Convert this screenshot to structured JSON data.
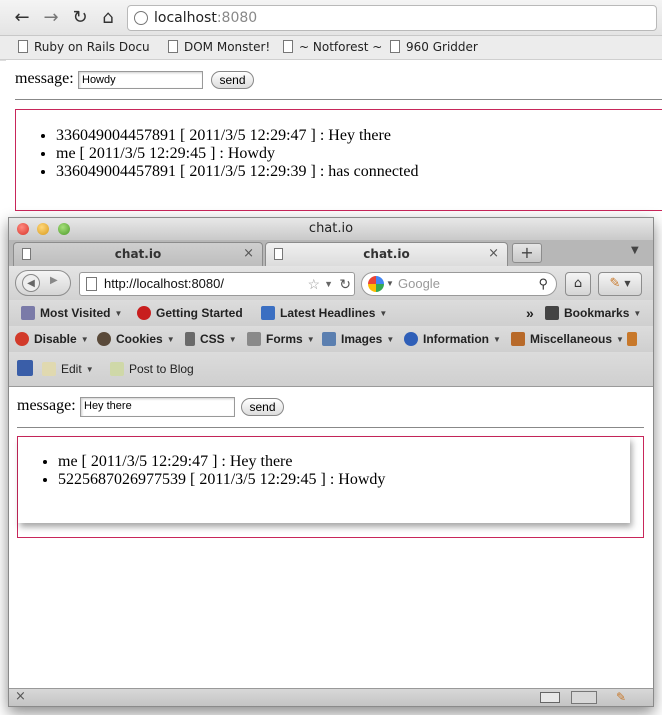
{
  "back_browser": {
    "url_host": "localhost",
    "url_port": ":8080",
    "bookmarks": [
      "Ruby on Rails Docum",
      "DOM Monster!",
      "~ Notforest ~",
      "960 Gridder"
    ],
    "page": {
      "message_label": "message:",
      "input_value": "Howdy",
      "send_label": "send",
      "messages": [
        "336049004457891 [ 2011/3/5 12:29:47 ] : Hey there",
        "me [ 2011/3/5 12:29:45 ] : Howdy",
        "336049004457891 [ 2011/3/5 12:29:39 ] : has connected"
      ]
    }
  },
  "front_window": {
    "title": "chat.io",
    "tabs": [
      {
        "label": "chat.io",
        "active": false
      },
      {
        "label": "chat.io",
        "active": true
      }
    ],
    "new_tab": "+",
    "url": "http://localhost:8080/",
    "search_placeholder": "Google",
    "bookmarks_bar": {
      "most_visited": "Most Visited",
      "getting_started": "Getting Started",
      "latest_headlines": "Latest Headlines",
      "bookmarks": "Bookmarks",
      "overflow": "»"
    },
    "webdev_bar": {
      "disable": "Disable",
      "cookies": "Cookies",
      "css": "CSS",
      "forms": "Forms",
      "images": "Images",
      "information": "Information",
      "miscellaneous": "Miscellaneous"
    },
    "blog_bar": {
      "edit": "Edit",
      "post_to_blog": "Post to Blog"
    },
    "page": {
      "message_label": "message:",
      "input_value": "Hey there",
      "send_label": "send",
      "messages": [
        "me [ 2011/3/5 12:29:47 ] : Hey there",
        "5225687026977539 [ 2011/3/5 12:29:45 ] : Howdy"
      ]
    },
    "status_close": "×"
  },
  "colors": {
    "message_box_border": "#c8265a"
  }
}
